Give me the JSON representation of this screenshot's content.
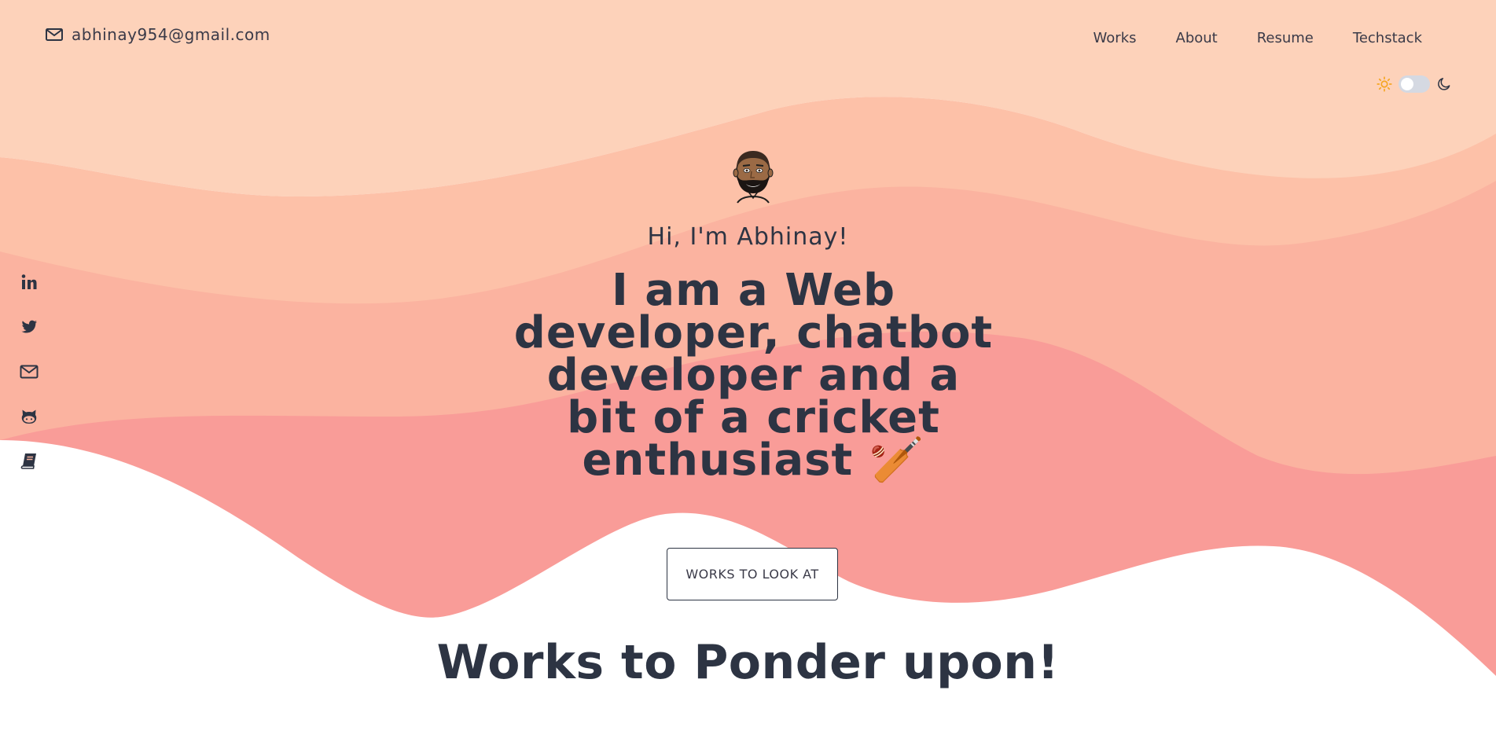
{
  "header": {
    "email": "abhinay954@gmail.com",
    "nav": [
      "Works",
      "About",
      "Resume",
      "Techstack"
    ]
  },
  "theme_toggle": {
    "mode": "light",
    "icons": [
      "sun-icon",
      "moon-icon"
    ]
  },
  "social_links": [
    "linkedin-icon",
    "twitter-icon",
    "mail-icon",
    "github-icon",
    "book-icon"
  ],
  "hero": {
    "greeting": "Hi, I'm Abhinay!",
    "headline": "I am a Web developer, chatbot developer and a bit of a cricket enthusiast 🏏",
    "cta_label": "WORKS TO LOOK AT"
  },
  "section": {
    "title": "Works to Ponder upon!"
  },
  "colors": {
    "wave1": "#fdd2ba",
    "wave2": "#fdc1a8",
    "wave3": "#fbb3a0",
    "wave4": "#f99c98",
    "text": "#2d3443",
    "toggle_track": "#d5d9e2",
    "sun": "#f5a623"
  }
}
